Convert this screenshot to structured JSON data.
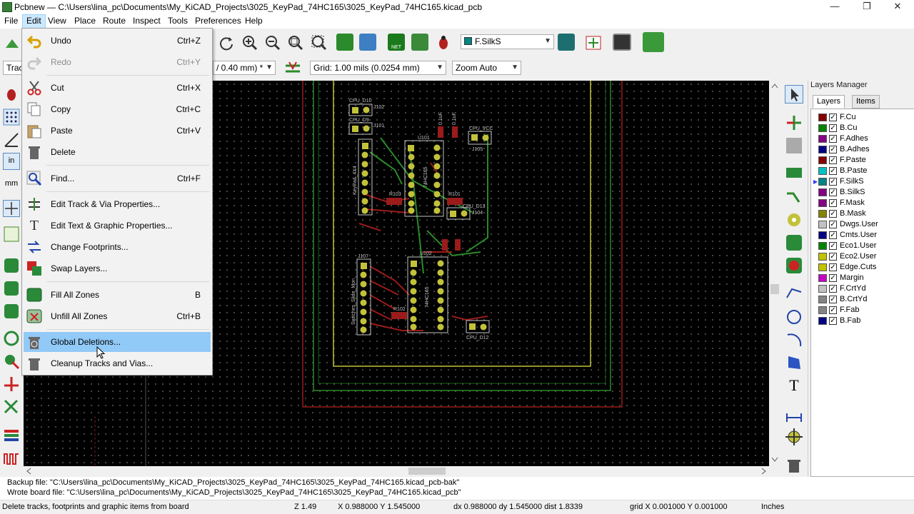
{
  "window": {
    "title": "Pcbnew — C:\\Users\\lina_pc\\Documents\\My_KiCAD_Projects\\3025_KeyPad_74HC165\\3025_KeyPad_74HC165.kicad_pcb",
    "minimize": "—",
    "restore": "❐",
    "close": "✕"
  },
  "menubar": [
    "File",
    "Edit",
    "View",
    "Place",
    "Route",
    "Inspect",
    "Tools",
    "Preferences",
    "Help"
  ],
  "toolbar": {
    "layer_select": "F.SilkS",
    "track_width": "/ 0.40 mm) *",
    "track_prefix": "Track",
    "grid": "Grid: 1.00 mils (0.0254 mm)",
    "zoom": "Zoom Auto"
  },
  "edit_menu": {
    "items": [
      {
        "label": "Undo",
        "shortcut": "Ctrl+Z",
        "icon": "undo-icon"
      },
      {
        "label": "Redo",
        "shortcut": "Ctrl+Y",
        "icon": "redo-icon",
        "disabled": true
      },
      {
        "label": "Cut",
        "shortcut": "Ctrl+X",
        "icon": "scissors-icon"
      },
      {
        "label": "Copy",
        "shortcut": "Ctrl+C",
        "icon": "copy-icon"
      },
      {
        "label": "Paste",
        "shortcut": "Ctrl+V",
        "icon": "paste-icon"
      },
      {
        "label": "Delete",
        "shortcut": "",
        "icon": "trash-icon"
      },
      {
        "label": "Find...",
        "shortcut": "Ctrl+F",
        "icon": "find-icon"
      },
      {
        "label": "Edit Track & Via Properties...",
        "shortcut": "",
        "icon": "track-props-icon"
      },
      {
        "label": "Edit Text & Graphic Properties...",
        "shortcut": "",
        "icon": "text-props-icon"
      },
      {
        "label": "Change Footprints...",
        "shortcut": "",
        "icon": "swap-footprint-icon"
      },
      {
        "label": "Swap Layers...",
        "shortcut": "",
        "icon": "swap-layers-icon"
      },
      {
        "label": "Fill All Zones",
        "shortcut": "B",
        "icon": "fill-zones-icon"
      },
      {
        "label": "Unfill All Zones",
        "shortcut": "Ctrl+B",
        "icon": "unfill-zones-icon"
      },
      {
        "label": "Global Deletions...",
        "shortcut": "",
        "icon": "global-delete-icon",
        "highlighted": true
      },
      {
        "label": "Cleanup Tracks and Vias...",
        "shortcut": "",
        "icon": "cleanup-icon"
      }
    ]
  },
  "layers_manager": {
    "title": "Layers Manager",
    "tabs": [
      "Layers",
      "Items"
    ],
    "active_layer": "F.SilkS",
    "layers": [
      {
        "name": "F.Cu",
        "color": "#840000",
        "checked": true
      },
      {
        "name": "B.Cu",
        "color": "#008400",
        "checked": true
      },
      {
        "name": "F.Adhes",
        "color": "#840084",
        "checked": true
      },
      {
        "name": "B.Adhes",
        "color": "#000084",
        "checked": true
      },
      {
        "name": "F.Paste",
        "color": "#840000",
        "checked": true
      },
      {
        "name": "B.Paste",
        "color": "#00c2c2",
        "checked": true
      },
      {
        "name": "F.SilkS",
        "color": "#008484",
        "checked": true
      },
      {
        "name": "B.SilkS",
        "color": "#840084",
        "checked": true
      },
      {
        "name": "F.Mask",
        "color": "#840084",
        "checked": true
      },
      {
        "name": "B.Mask",
        "color": "#848400",
        "checked": true
      },
      {
        "name": "Dwgs.User",
        "color": "#c2c2c2",
        "checked": true
      },
      {
        "name": "Cmts.User",
        "color": "#000084",
        "checked": true
      },
      {
        "name": "Eco1.User",
        "color": "#008400",
        "checked": true
      },
      {
        "name": "Eco2.User",
        "color": "#c2c200",
        "checked": true
      },
      {
        "name": "Edge.Cuts",
        "color": "#c2c200",
        "checked": true
      },
      {
        "name": "Margin",
        "color": "#c200c2",
        "checked": true
      },
      {
        "name": "F.CrtYd",
        "color": "#c2c2c2",
        "checked": true
      },
      {
        "name": "B.CrtYd",
        "color": "#848484",
        "checked": true
      },
      {
        "name": "F.Fab",
        "color": "#848484",
        "checked": true
      },
      {
        "name": "B.Fab",
        "color": "#000084",
        "checked": true
      }
    ]
  },
  "pcb_labels": {
    "j102": "J102",
    "cpu_d10": "CPU_D10",
    "cpu_d9": "CPU_D9",
    "j101": "J101",
    "keypad": "KeyPad_4X4",
    "u101": "U101",
    "hc165_a": "74HC165",
    "r103": "R103",
    "r101": "R101",
    "c101": "C101",
    "cpu_vcc": "CPU_VCC",
    "j105": "J105",
    "cpu_d13": "CPU_D13",
    "j104": "J104",
    "c102": "C102",
    "u102": "U102",
    "hc165_b": "74HC165",
    "j107": "J107",
    "switches": "Switches_Slide_Mon",
    "r102": "R102",
    "cpu_d12": "CPU_D12",
    "cap1": "0.1uF",
    "cap2": "0.1uF"
  },
  "messages": [
    "Backup file: \"C:\\Users\\lina_pc\\Documents\\My_KiCAD_Projects\\3025_KeyPad_74HC165\\3025_KeyPad_74HC165.kicad_pcb-bak\"",
    "Wrote board file: \"C:\\Users\\lina_pc\\Documents\\My_KiCAD_Projects\\3025_KeyPad_74HC165\\3025_KeyPad_74HC165.kicad_pcb\""
  ],
  "status": {
    "hint": "Delete tracks, footprints and graphic items from board",
    "zoom": "Z 1.49",
    "xy": "X 0.988000  Y 1.545000",
    "delta": "dx 0.988000  dy 1.545000  dist 1.8339",
    "grid": "grid X 0.001000  Y 0.001000",
    "units": "Inches"
  }
}
